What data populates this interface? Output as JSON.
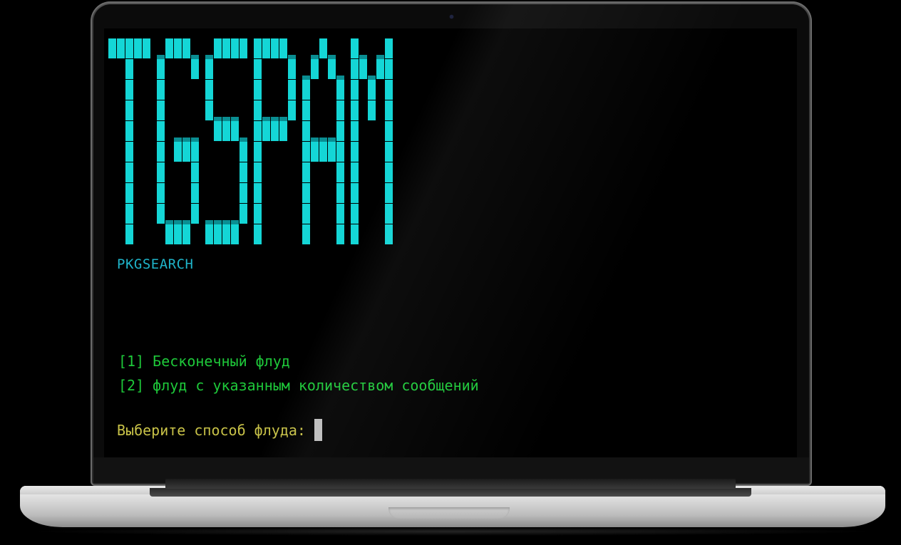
{
  "terminal": {
    "banner": {
      "letters": [
        "T",
        "G",
        "S",
        "P",
        "A",
        "M"
      ],
      "color": "#14d6d6"
    },
    "tagline": "PKGSEARCH",
    "menu": {
      "items": [
        "[1] Бесконечный флуд",
        "[2] флуд с указанным количеством сообщений"
      ]
    },
    "prompt": "Выберите способ флуда:"
  },
  "colors": {
    "menu_text": "#1ec93a",
    "prompt_text": "#c8c248",
    "tagline_text": "#1fb4c9",
    "background": "#000000"
  }
}
